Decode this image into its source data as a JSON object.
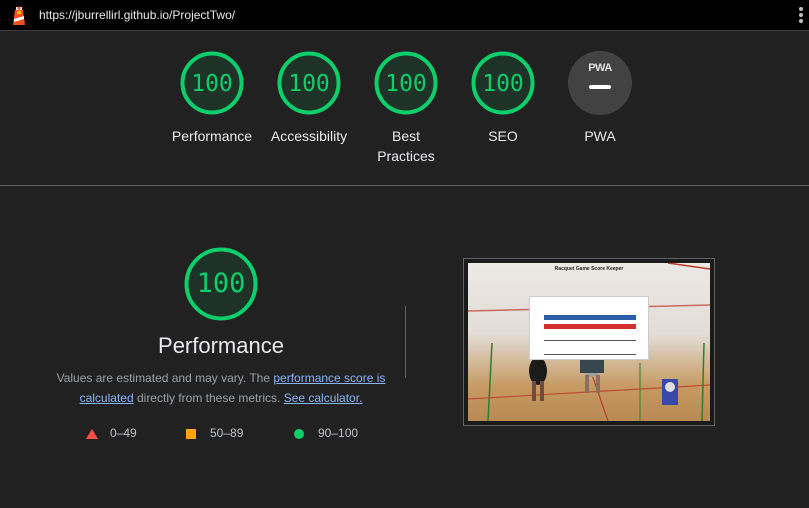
{
  "browser": {
    "url": "https://jburrellirl.github.io/ProjectTwo/",
    "logo_icon": "lighthouse-icon",
    "menu_icon": "kebab-menu-icon"
  },
  "gauges": [
    {
      "id": "performance",
      "score": "100",
      "label": "Performance",
      "status": "pass"
    },
    {
      "id": "accessibility",
      "score": "100",
      "label": "Accessibility",
      "status": "pass"
    },
    {
      "id": "best-practices",
      "score": "100",
      "label": "Best Practices",
      "status": "pass"
    },
    {
      "id": "seo",
      "score": "100",
      "label": "SEO",
      "status": "pass"
    },
    {
      "id": "pwa",
      "badge": "PWA",
      "label": "PWA",
      "status": "not-applicable"
    }
  ],
  "performance": {
    "score": "100",
    "title": "Performance",
    "description_prefix": "Values are estimated and may vary. The ",
    "link_score": "performance score is calculated",
    "description_middle": " directly from these metrics. ",
    "link_calculator": "See calculator."
  },
  "legend": [
    {
      "shape": "triangle",
      "range": "0–49",
      "color": "#ff4e42"
    },
    {
      "shape": "square",
      "range": "50–89",
      "color": "#ffa400"
    },
    {
      "shape": "circle",
      "range": "90–100",
      "color": "#0cce6b"
    }
  ],
  "thumbnail": {
    "title": "Racquet Game Score Keeper"
  },
  "colors": {
    "pass": "#0cce6b",
    "average": "#ffa400",
    "fail": "#ff4e42",
    "background": "#212121",
    "link": "#8ab4f8"
  }
}
